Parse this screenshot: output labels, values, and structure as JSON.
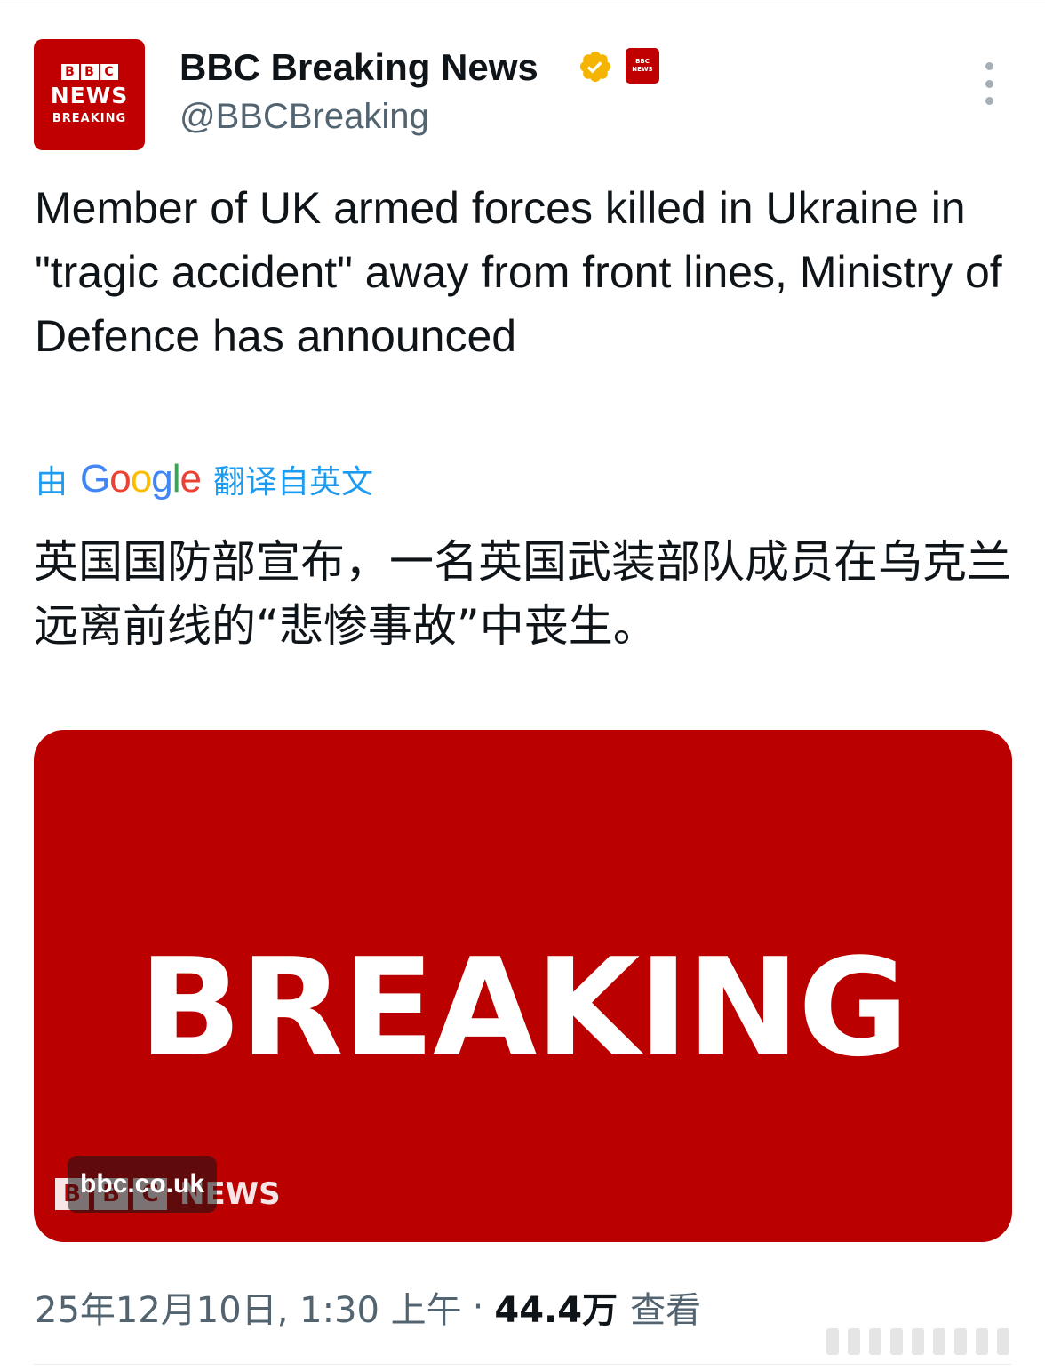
{
  "author": {
    "avatar": {
      "bbc_letters": [
        "B",
        "B",
        "C"
      ],
      "line1": "NEWS",
      "line2": "BREAKING",
      "color": "#c00000"
    },
    "display_name": "BBC Breaking News",
    "handle": "@BBCBreaking",
    "verified_badge_color": "#f4b400",
    "affiliate_badge": {
      "bbc_letters": "BBC",
      "line": "NEWS"
    },
    "more_icon": "more-vertical-icon"
  },
  "tweet": {
    "text": "Member of UK armed forces killed in Ukraine in \"tragic accident\" away from front lines, Ministry of Defence has announced",
    "translation_prefix": "由",
    "translation_brand": [
      "G",
      "o",
      "o",
      "g",
      "l",
      "e"
    ],
    "translation_suffix": "翻译自英文",
    "translated_text": "英国国防部宣布，一名英国武装部队成员在乌克兰远离前线的“悲惨事故”中丧生。"
  },
  "media": {
    "headline": "BREAKING",
    "logo_letters": [
      "B",
      "B",
      "C"
    ],
    "logo_word": "NEWS",
    "source_label": "bbc.co.uk",
    "background_color": "#bb0000"
  },
  "meta": {
    "timestamp": "25年12月10日, 1:30 上午",
    "separator": "·",
    "views_count": "44.4万",
    "views_label": "查看"
  },
  "colors": {
    "link_blue": "#1d9bf0",
    "secondary_text": "#536471",
    "primary_text": "#0f1419"
  }
}
